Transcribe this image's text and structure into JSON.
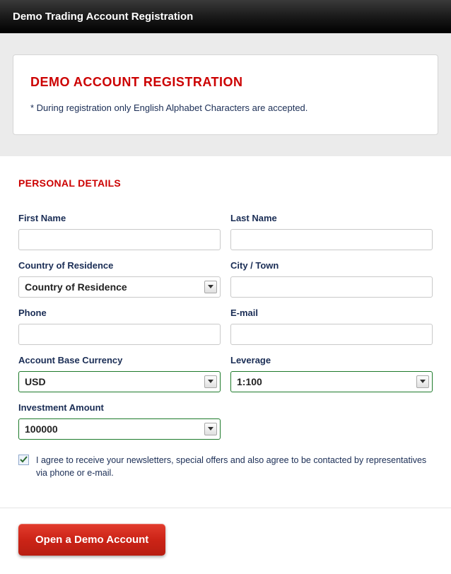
{
  "window": {
    "title": "Demo Trading Account Registration"
  },
  "intro": {
    "heading": "DEMO ACCOUNT REGISTRATION",
    "note": "* During registration only English Alphabet Characters are accepted."
  },
  "section": {
    "personal_details": "PERSONAL DETAILS"
  },
  "fields": {
    "first_name": {
      "label": "First Name",
      "value": ""
    },
    "last_name": {
      "label": "Last Name",
      "value": ""
    },
    "country": {
      "label": "Country of Residence",
      "selected": "Country of Residence"
    },
    "city": {
      "label": "City / Town",
      "value": ""
    },
    "phone": {
      "label": "Phone",
      "value": ""
    },
    "email": {
      "label": "E-mail",
      "value": ""
    },
    "currency": {
      "label": "Account Base Currency",
      "selected": "USD"
    },
    "leverage": {
      "label": "Leverage",
      "selected": "1:100"
    },
    "investment": {
      "label": "Investment Amount",
      "selected": "100000"
    }
  },
  "consent": {
    "checked": true,
    "text": "I agree to receive your newsletters, special offers and also agree to be contacted by representatives via phone or e-mail."
  },
  "submit": {
    "label": "Open a Demo Account"
  }
}
